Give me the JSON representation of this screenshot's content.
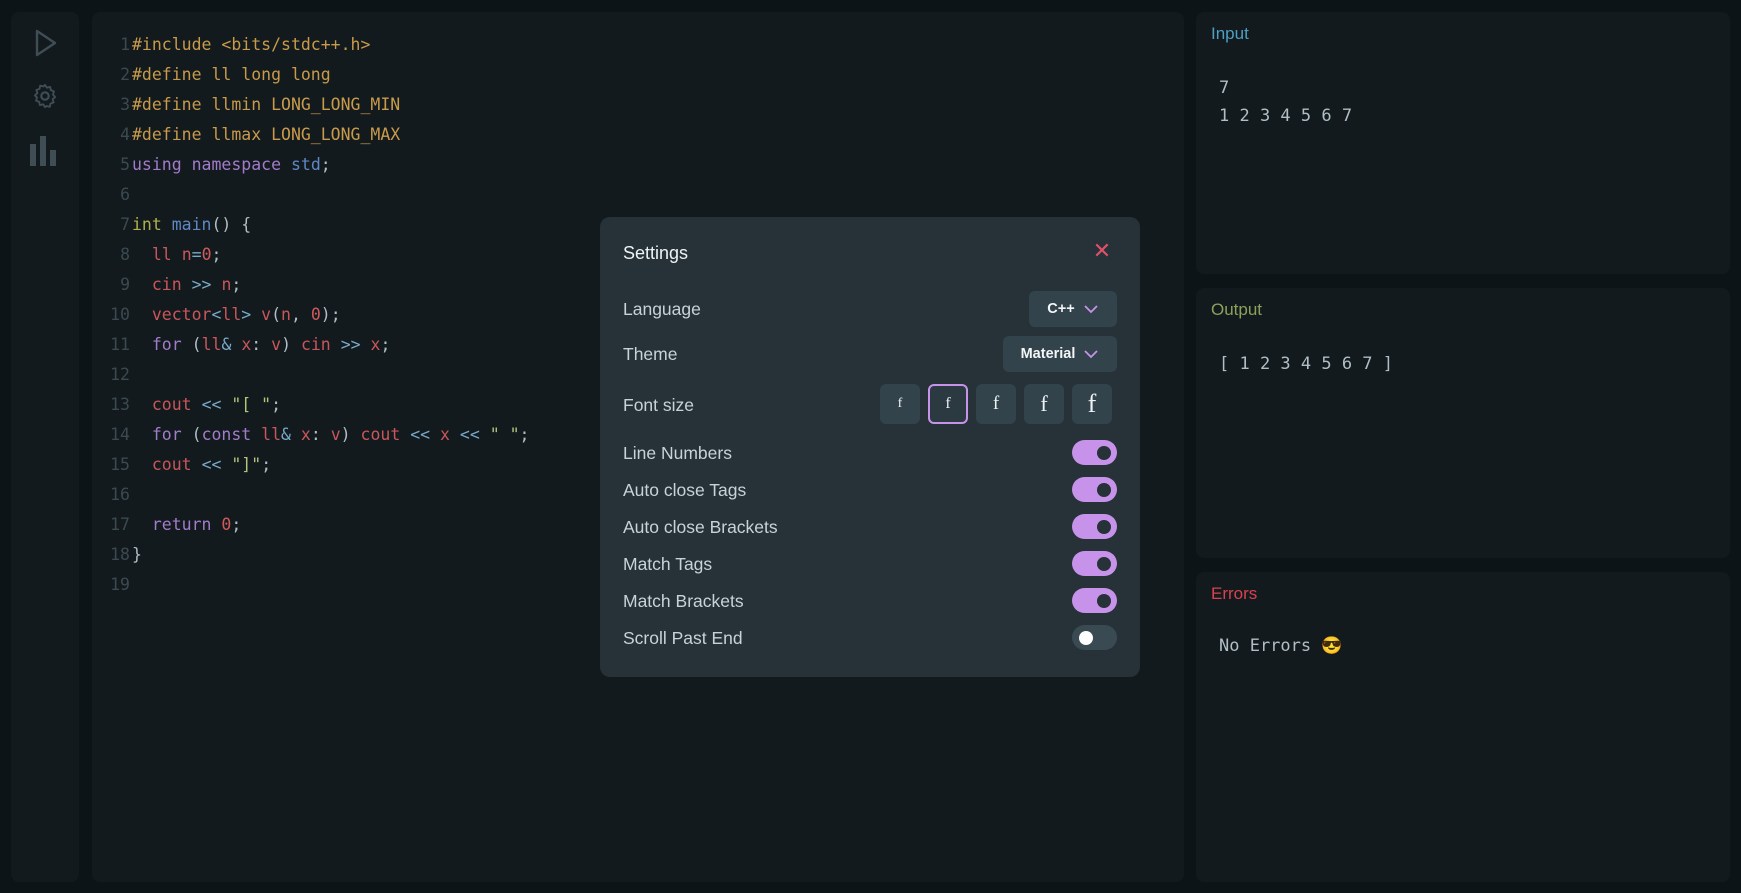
{
  "sidebar": {
    "icons": [
      "play-icon",
      "gear-icon",
      "bar-chart-icon"
    ]
  },
  "editor": {
    "lines": [
      {
        "n": "1"
      },
      {
        "n": "2"
      },
      {
        "n": "3"
      },
      {
        "n": "4"
      },
      {
        "n": "5"
      },
      {
        "n": "6"
      },
      {
        "n": "7"
      },
      {
        "n": "8"
      },
      {
        "n": "9"
      },
      {
        "n": "10"
      },
      {
        "n": "11"
      },
      {
        "n": "12"
      },
      {
        "n": "13"
      },
      {
        "n": "14"
      },
      {
        "n": "15"
      },
      {
        "n": "16"
      },
      {
        "n": "17"
      },
      {
        "n": "18"
      },
      {
        "n": "19"
      }
    ],
    "code": {
      "l1": "#include <bits/stdc++.h>",
      "l2": "#define ll long long",
      "l3": "#define llmin LONG_LONG_MIN",
      "l4": "#define llmax LONG_LONG_MAX",
      "l5a": "using",
      "l5b": "namespace",
      "l5c": "std",
      "l5d": ";",
      "l7a": "int",
      "l7b": "main",
      "l7c": "() {",
      "l8a": "ll",
      "l8b": "n",
      "l8c": "=",
      "l8d": "0",
      "l8e": ";",
      "l9a": "cin",
      "l9b": ">>",
      "l9c": "n",
      "l9d": ";",
      "l10a": "vector",
      "l10b": "<",
      "l10c": "ll",
      "l10d": ">",
      "l10e": "v",
      "l10f": "(",
      "l10g": "n",
      "l10h": ", ",
      "l10i": "0",
      "l10j": ");",
      "l11a": "for",
      "l11b": "(",
      "l11c": "ll",
      "l11d": "&",
      "l11e": "x",
      "l11f": ":",
      "l11g": "v",
      "l11h": ")",
      "l11i": "cin",
      "l11j": ">>",
      "l11k": "x",
      "l11l": ";",
      "l13a": "cout",
      "l13b": "<<",
      "l13c": "\"[ \"",
      "l13d": ";",
      "l14a": "for",
      "l14b": "(",
      "l14c": "const",
      "l14d": "ll",
      "l14e": "&",
      "l14f": "x",
      "l14g": ":",
      "l14h": "v",
      "l14i": ")",
      "l14j": "cout",
      "l14k": "<<",
      "l14l": "x",
      "l14m": "<<",
      "l14n": "\" \"",
      "l14o": ";",
      "l15a": "cout",
      "l15b": "<<",
      "l15c": "\"]\"",
      "l15d": ";",
      "l17a": "return",
      "l17b": "0",
      "l17c": ";",
      "l18": "}"
    }
  },
  "input_panel": {
    "title": "Input",
    "body": "7\n1 2 3 4 5 6 7"
  },
  "output_panel": {
    "title": "Output",
    "body": "[ 1 2 3 4 5 6 7 ]"
  },
  "errors_panel": {
    "title": "Errors",
    "body": "No Errors 😎"
  },
  "settings": {
    "title": "Settings",
    "close_label": "✕",
    "language_label": "Language",
    "language_value": "C++",
    "theme_label": "Theme",
    "theme_value": "Material",
    "font_size_label": "Font size",
    "font_size_options": [
      "f",
      "f",
      "f",
      "f",
      "f"
    ],
    "font_size_selected_index": 1,
    "toggles": [
      {
        "label": "Line Numbers",
        "on": true
      },
      {
        "label": "Auto close Tags",
        "on": true
      },
      {
        "label": "Auto close Brackets",
        "on": true
      },
      {
        "label": "Match Tags",
        "on": true
      },
      {
        "label": "Match Brackets",
        "on": true
      },
      {
        "label": "Scroll Past End",
        "on": false
      }
    ]
  },
  "colors": {
    "accent": "#c792ea",
    "input_title": "#4f9fc2",
    "output_title": "#8fa05a",
    "errors_title": "#d9414f",
    "close": "#e0506a"
  }
}
